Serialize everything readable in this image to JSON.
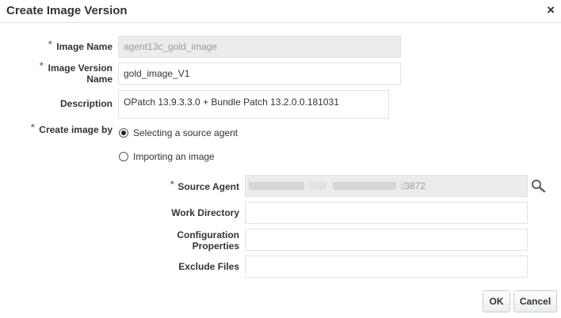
{
  "dialog": {
    "title": "Create Image Version",
    "close_symbol": "×"
  },
  "form": {
    "required_marker": "*",
    "image_name": {
      "label": "Image Name",
      "value": "agent13c_gold_image"
    },
    "image_version_name": {
      "label_line1": "Image Version",
      "label_line2": "Name",
      "value": "gold_image_V1"
    },
    "description": {
      "label": "Description",
      "value": "OPatch 13.9.3.3.0 + Bundle Patch 13.2.0.0.181031"
    },
    "create_image_by": {
      "label": "Create image by",
      "options": [
        {
          "label": "Selecting a source agent",
          "selected": true
        },
        {
          "label": "Importing an image",
          "selected": false
        }
      ]
    },
    "source_agent": {
      "label": "Source Agent",
      "value_suffix": ":3872",
      "search_icon": "magnifier-icon"
    },
    "work_directory": {
      "label": "Work Directory",
      "value": ""
    },
    "configuration_properties": {
      "label_line1": "Configuration",
      "label_line2": "Properties",
      "value": ""
    },
    "exclude_files": {
      "label": "Exclude Files",
      "value": ""
    }
  },
  "buttons": {
    "ok": "OK",
    "cancel": "Cancel"
  },
  "colors": {
    "required_marker": "#4a7fc1",
    "readonly_bg": "#ececec"
  }
}
